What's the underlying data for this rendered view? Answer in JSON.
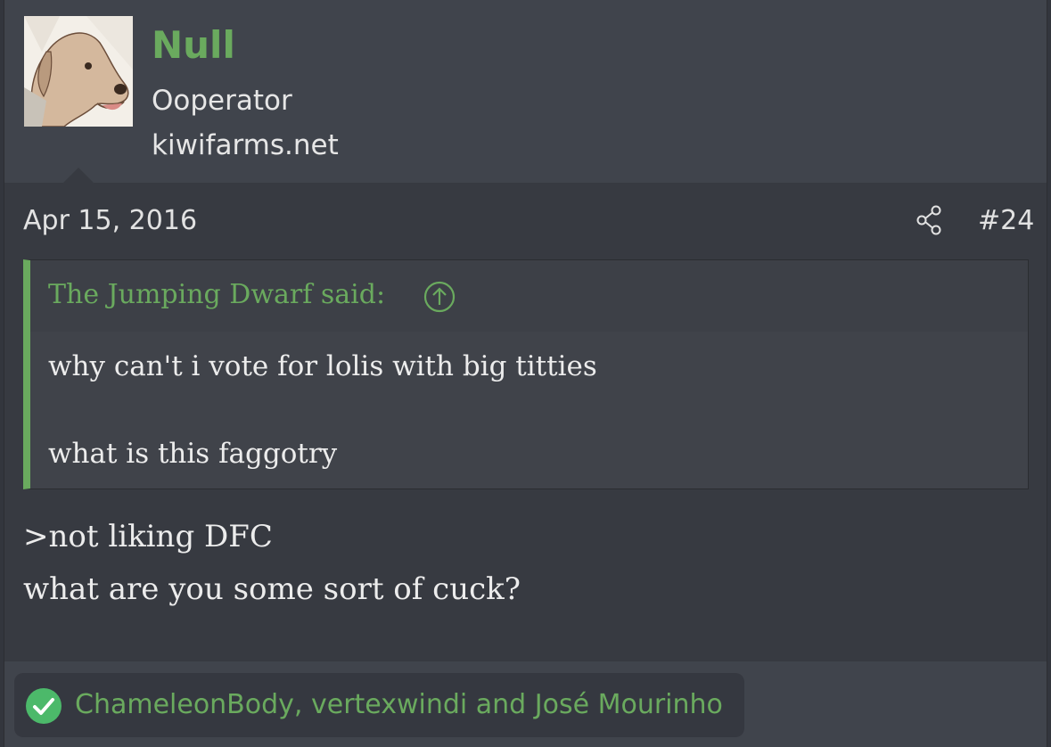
{
  "user": {
    "name": "Null",
    "title": "Ooperator",
    "site": "kiwifarms.net"
  },
  "post": {
    "date": "Apr 15, 2016",
    "number": "#24",
    "quote": {
      "attribution": "The Jumping Dwarf said:",
      "line1": "why can't i vote for lolis with big titties",
      "line2": "what is this faggotry"
    },
    "body": {
      "line1": ">not liking DFC",
      "line2": "what are you some sort of cuck?"
    },
    "reactions": "ChameleonBody, vertexwindi and José Mourinho"
  },
  "colors": {
    "accent": "#6aaa5e",
    "background": "#373a41",
    "header": "#40444c"
  },
  "icons": {
    "share": "share-icon",
    "quote_jump": "arrow-up-circle-icon",
    "reaction": "check-circle-icon"
  }
}
